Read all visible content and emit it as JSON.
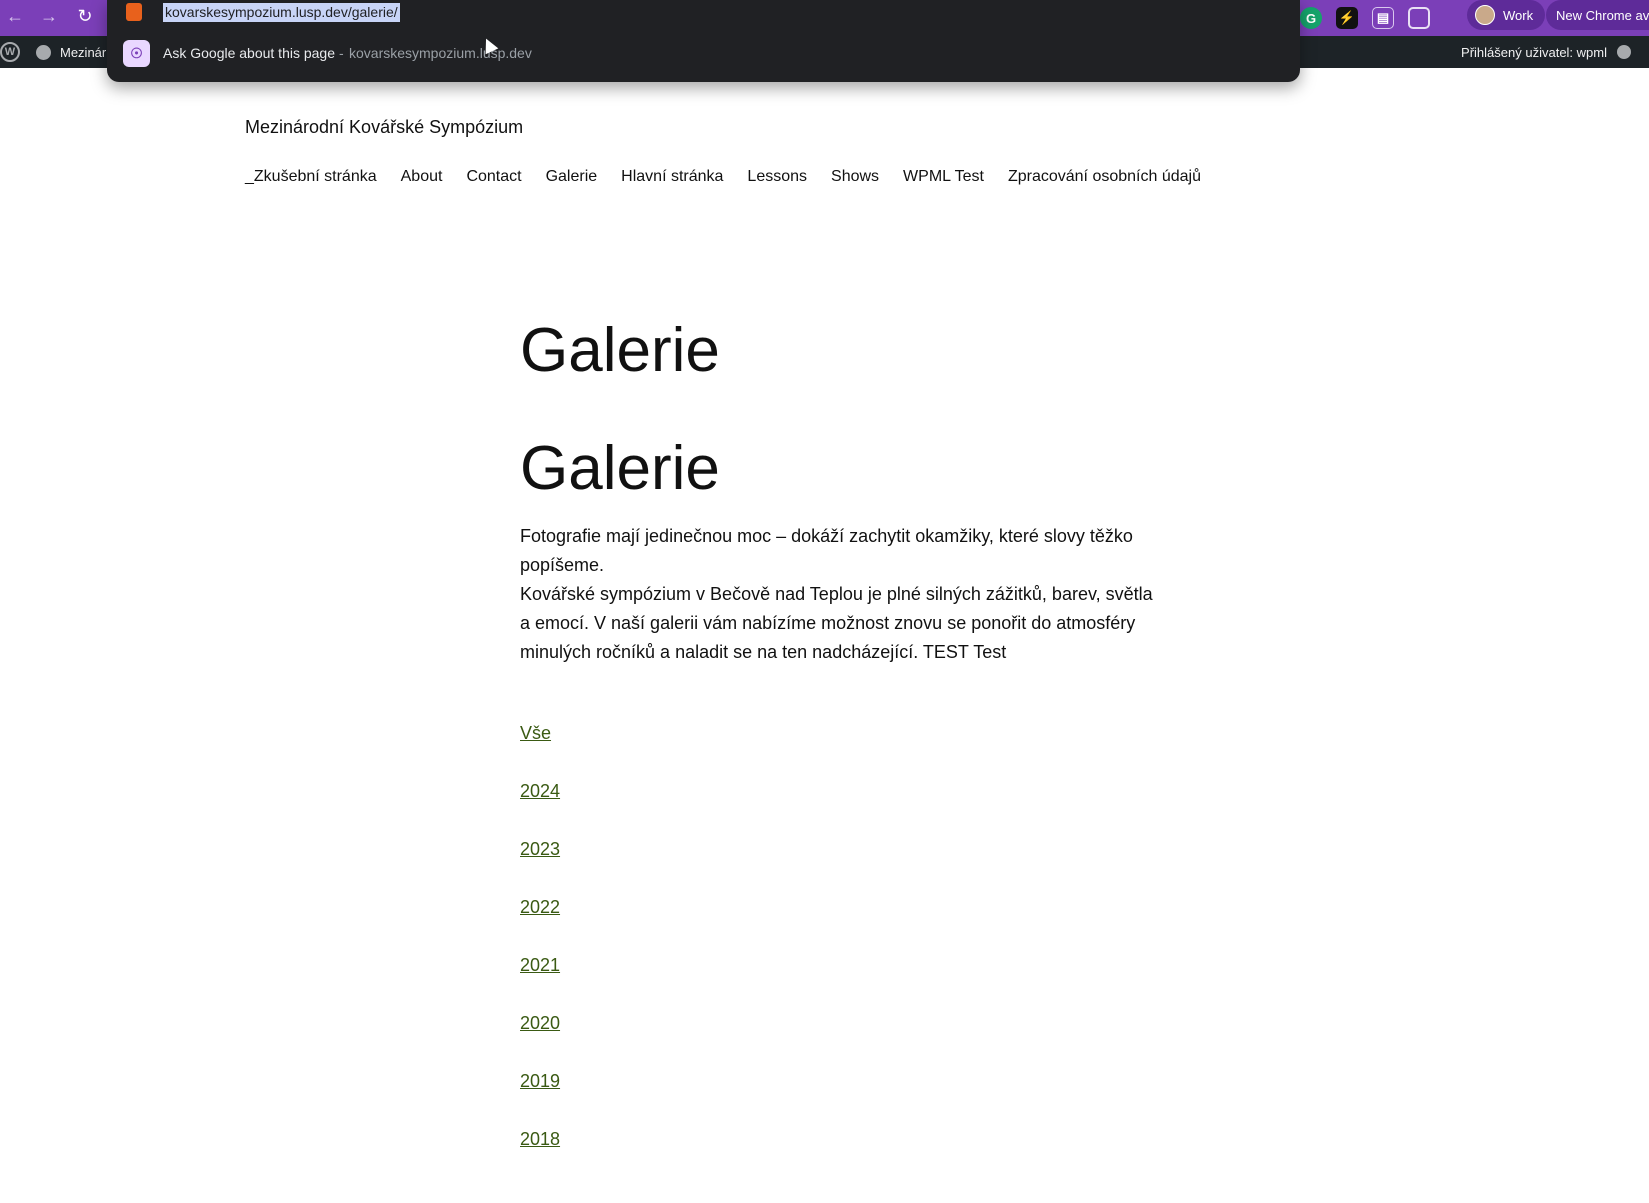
{
  "browser": {
    "url": "kovarskesympozium.lusp.dev/galerie/",
    "omnibox_suggestion": "Ask Google about this page",
    "omnibox_separator": "-",
    "omnibox_domain": "kovarskesympozium.lusp.dev",
    "profile_label": "Work",
    "new_chrome_label": "New Chrome ava",
    "colors": {
      "frame": "#7b3fb8",
      "omnibox_bg": "#202124",
      "url_highlight": "#c8d4f7"
    }
  },
  "wp_admin_bar": {
    "site_label": "Mezinár",
    "user_label": "Přihlášený uživatel: wpml"
  },
  "site": {
    "title": "Mezinárodní Kovářské Sympózium",
    "nav": [
      "_Zkušební stránka",
      "About",
      "Contact",
      "Galerie",
      "Hlavní stránka",
      "Lessons",
      "Shows",
      "WPML Test",
      "Zpracování osobních údajů"
    ]
  },
  "page": {
    "title": "Galerie",
    "heading": "Galerie",
    "intro_line1": "Fotografie mají jedinečnou moc – dokáží zachytit okamžiky, které slovy těžko popíšeme.",
    "intro_line2": "Kovářské sympózium v Bečově nad Teplou je plné silných zážitků, barev, světla a emocí. V naší galerii vám nabízíme možnost znovu se ponořit do atmosféry minulých ročníků a naladit se na ten nadcházející. TEST Test",
    "year_links": [
      "Vše",
      "2024",
      "2023",
      "2022",
      "2021",
      "2020",
      "2019",
      "2018"
    ],
    "colors": {
      "link": "#3a5a13"
    }
  }
}
